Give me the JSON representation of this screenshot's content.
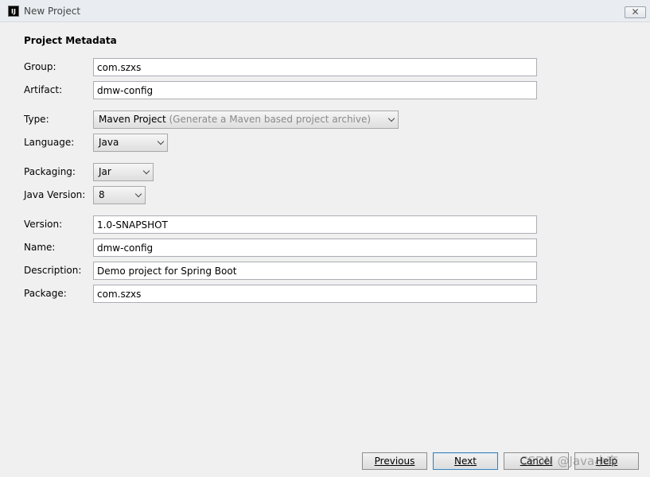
{
  "window": {
    "title": "New Project",
    "close_glyph": "✕",
    "icon_text": "IJ"
  },
  "section_title": "Project Metadata",
  "labels": {
    "group": "Group:",
    "artifact": "Artifact:",
    "type": "Type:",
    "language": "Language:",
    "packaging": "Packaging:",
    "java_version": "Java Version:",
    "version": "Version:",
    "name": "Name:",
    "description": "Description:",
    "package": "Package:"
  },
  "fields": {
    "group": "com.szxs",
    "artifact": "dmw-config",
    "version": "1.0-SNAPSHOT",
    "name": "dmw-config",
    "description": "Demo project for Spring Boot",
    "package": "com.szxs"
  },
  "selects": {
    "type": "Maven Project",
    "type_hint": "(Generate a Maven based project archive)",
    "language": "Java",
    "packaging": "Jar",
    "java_version": "8"
  },
  "buttons": {
    "previous": "Previous",
    "next": "Next",
    "cancel": "Cancel",
    "help": "Help"
  },
  "watermark": "CSDN @Java小奔",
  "icons": {
    "app": "intellij-icon",
    "close": "close-icon",
    "dropdown": "chevron-down-icon"
  },
  "colors": {
    "focus_border": "#3c7fb1",
    "window_bg": "#f0f0f0",
    "hint_text": "#8a8a8a"
  }
}
